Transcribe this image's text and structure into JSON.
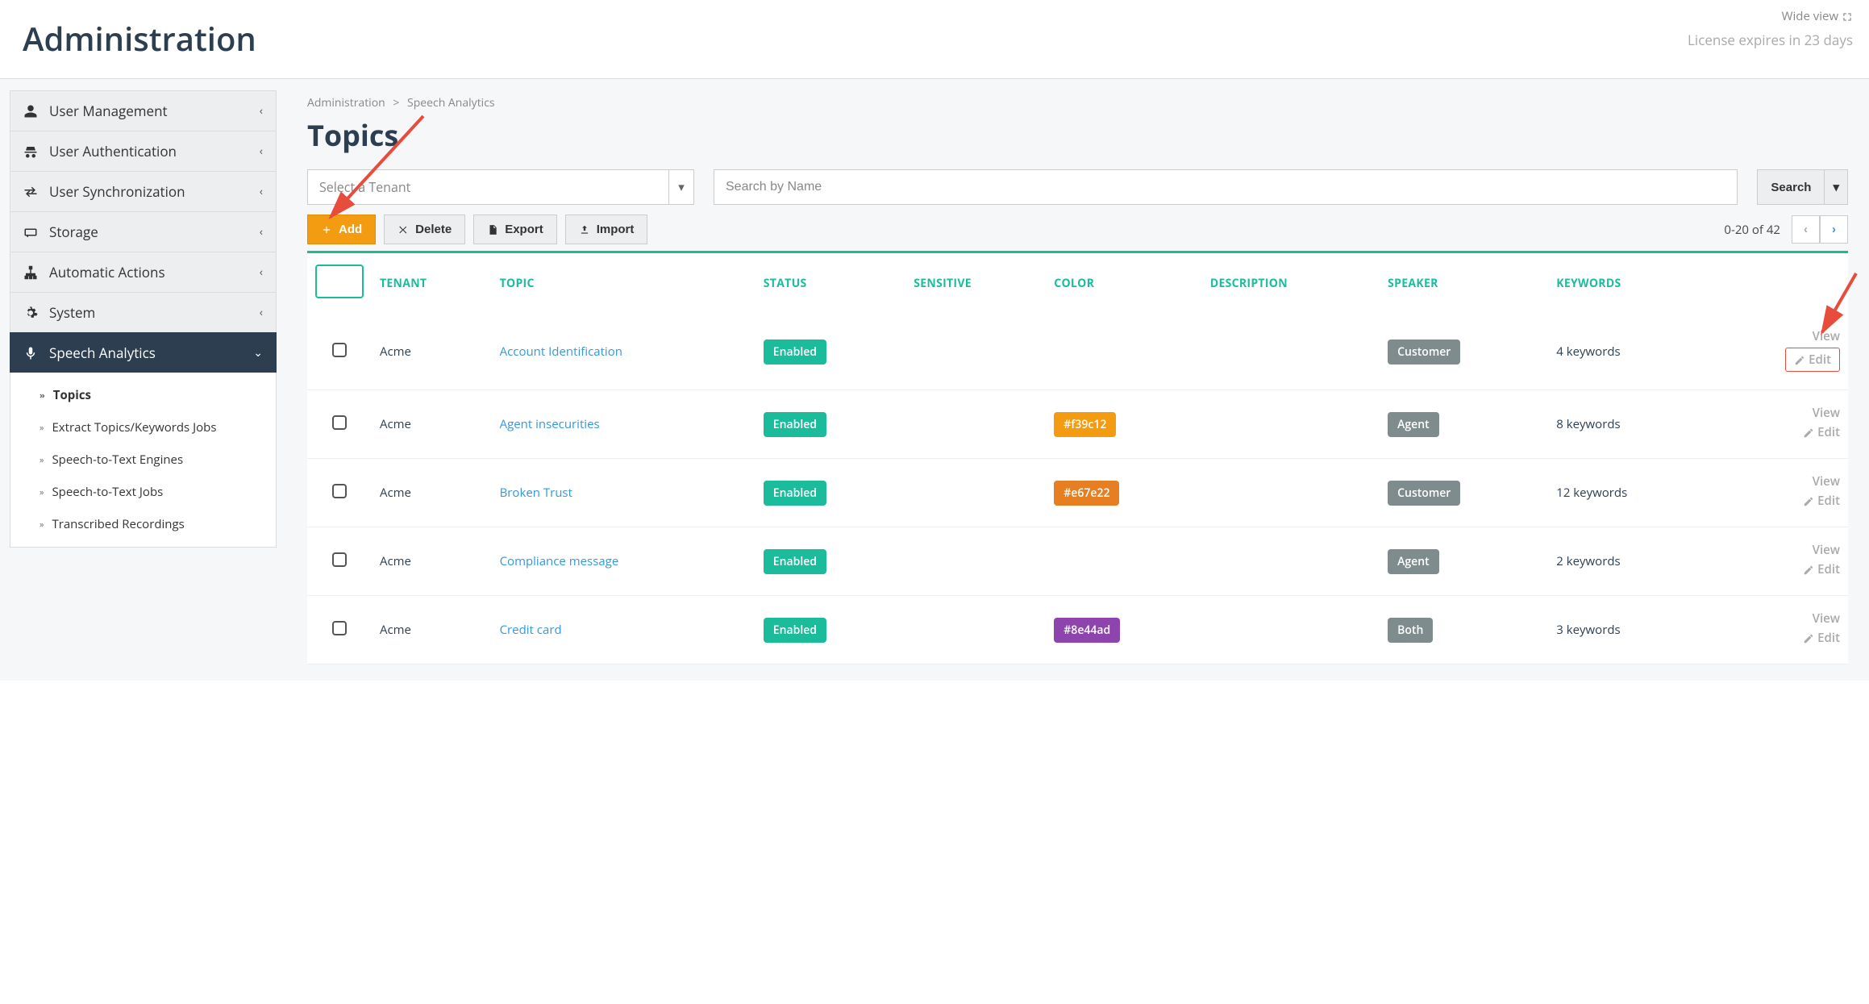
{
  "header": {
    "title": "Administration",
    "wide_view": "Wide view",
    "license": "License expires in 23 days"
  },
  "sidebar": {
    "items": [
      {
        "label": "User Management"
      },
      {
        "label": "User Authentication"
      },
      {
        "label": "User Synchronization"
      },
      {
        "label": "Storage"
      },
      {
        "label": "Automatic Actions"
      },
      {
        "label": "System"
      },
      {
        "label": "Speech Analytics"
      }
    ],
    "sub": [
      {
        "label": "Topics"
      },
      {
        "label": "Extract Topics/Keywords Jobs"
      },
      {
        "label": "Speech-to-Text Engines"
      },
      {
        "label": "Speech-to-Text Jobs"
      },
      {
        "label": "Transcribed Recordings"
      }
    ]
  },
  "breadcrumb": {
    "a": "Administration",
    "sep": ">",
    "b": "Speech Analytics"
  },
  "page": {
    "title": "Topics"
  },
  "tenant_select": {
    "placeholder": "Select a Tenant"
  },
  "search": {
    "placeholder": "Search by Name",
    "button": "Search"
  },
  "toolbar": {
    "add": "Add",
    "delete": "Delete",
    "export": "Export",
    "import": "Import"
  },
  "pagination": {
    "range": "0-20 of 42"
  },
  "columns": {
    "tenant": "TENANT",
    "topic": "TOPIC",
    "status": "STATUS",
    "sensitive": "SENSITIVE",
    "color": "COLOR",
    "description": "DESCRIPTION",
    "speaker": "SPEAKER",
    "keywords": "KEYWORDS"
  },
  "actions": {
    "view": "View",
    "edit": "Edit"
  },
  "rows": [
    {
      "tenant": "Acme",
      "topic": "Account Identification",
      "status": "Enabled",
      "color": "",
      "speaker": "Customer",
      "keywords": "4 keywords",
      "highlight_edit": true
    },
    {
      "tenant": "Acme",
      "topic": "Agent insecurities",
      "status": "Enabled",
      "color": "#f39c12",
      "speaker": "Agent",
      "keywords": "8 keywords"
    },
    {
      "tenant": "Acme",
      "topic": "Broken Trust",
      "status": "Enabled",
      "color": "#e67e22",
      "speaker": "Customer",
      "keywords": "12 keywords"
    },
    {
      "tenant": "Acme",
      "topic": "Compliance message",
      "status": "Enabled",
      "color": "",
      "speaker": "Agent",
      "keywords": "2 keywords"
    },
    {
      "tenant": "Acme",
      "topic": "Credit card",
      "status": "Enabled",
      "color": "#8e44ad",
      "speaker": "Both",
      "keywords": "3 keywords"
    }
  ]
}
